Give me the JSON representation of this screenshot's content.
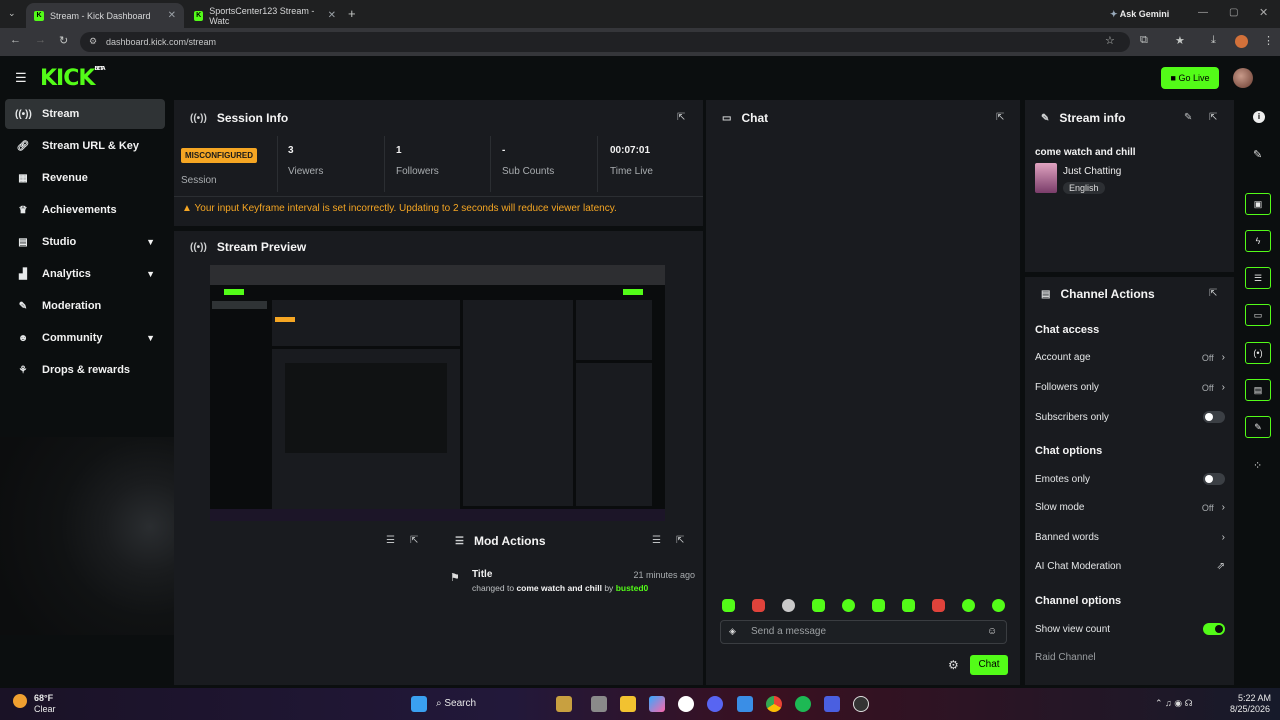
{
  "browser": {
    "tabs": [
      {
        "title": "Stream - Kick Dashboard",
        "favicon": "K"
      },
      {
        "title": "SportsCenter123 Stream - Watc",
        "favicon": "K"
      }
    ],
    "url": "dashboard.kick.com/stream",
    "ask_gemini": "Ask Gemini"
  },
  "header": {
    "logo": "KICK",
    "logo_tag": "BETA",
    "go_live": "Go Live"
  },
  "sidebar": {
    "items": [
      {
        "label": "Stream",
        "icon": "broadcast-icon"
      },
      {
        "label": "Stream URL & Key",
        "icon": "link-icon"
      },
      {
        "label": "Revenue",
        "icon": "revenue-icon"
      },
      {
        "label": "Achievements",
        "icon": "trophy-icon"
      },
      {
        "label": "Studio",
        "icon": "studio-icon"
      },
      {
        "label": "Analytics",
        "icon": "analytics-icon"
      },
      {
        "label": "Moderation",
        "icon": "wrench-icon"
      },
      {
        "label": "Community",
        "icon": "community-icon"
      },
      {
        "label": "Drops & rewards",
        "icon": "gift-icon"
      }
    ]
  },
  "session_info": {
    "title": "Session Info",
    "badge": "MISCONFIGURED",
    "badge_label": "Session",
    "stats": [
      {
        "value": "3",
        "label": "Viewers"
      },
      {
        "value": "1",
        "label": "Followers"
      },
      {
        "value": "-",
        "label": "Sub Counts"
      },
      {
        "value": "00:07:01",
        "label": "Time Live"
      }
    ],
    "warning": "Your input Keyframe interval is set incorrectly. Updating to 2 seconds will reduce viewer latency."
  },
  "stream_preview": {
    "title": "Stream Preview"
  },
  "chat": {
    "title": "Chat",
    "placeholder": "Send a message",
    "send_label": "Chat"
  },
  "mod_actions": {
    "title": "Mod Actions",
    "entries": [
      {
        "action": "Title",
        "time": "21 minutes ago",
        "prefix": "changed to",
        "value": "come watch and chill",
        "by_word": "by",
        "user": "busted0"
      }
    ]
  },
  "stream_info": {
    "title": "Stream info",
    "stream_title": "come watch and chill",
    "category": "Just Chatting",
    "language": "English"
  },
  "channel_actions": {
    "title": "Channel Actions",
    "chat_access": {
      "heading": "Chat access",
      "rows": [
        {
          "label": "Account age",
          "value": "Off"
        },
        {
          "label": "Followers only",
          "value": "Off"
        },
        {
          "label": "Subscribers only",
          "value": ""
        }
      ]
    },
    "chat_options": {
      "heading": "Chat options",
      "rows": [
        {
          "label": "Emotes only",
          "value": ""
        },
        {
          "label": "Slow mode",
          "value": "Off"
        },
        {
          "label": "Banned words",
          "value": ""
        },
        {
          "label": "AI Chat Moderation",
          "value": ""
        }
      ]
    },
    "channel_options": {
      "heading": "Channel options",
      "rows": [
        {
          "label": "Show view count",
          "value": ""
        },
        {
          "label": "Raid Channel",
          "value": ""
        }
      ]
    }
  },
  "taskbar": {
    "weather_temp": "68°F",
    "weather_desc": "Clear",
    "search": "Search",
    "time": "5:22 AM",
    "date": "8/25/2026"
  },
  "colors": {
    "accent": "#53fc18",
    "warning": "#f5a623",
    "panel": "#191b1f"
  }
}
